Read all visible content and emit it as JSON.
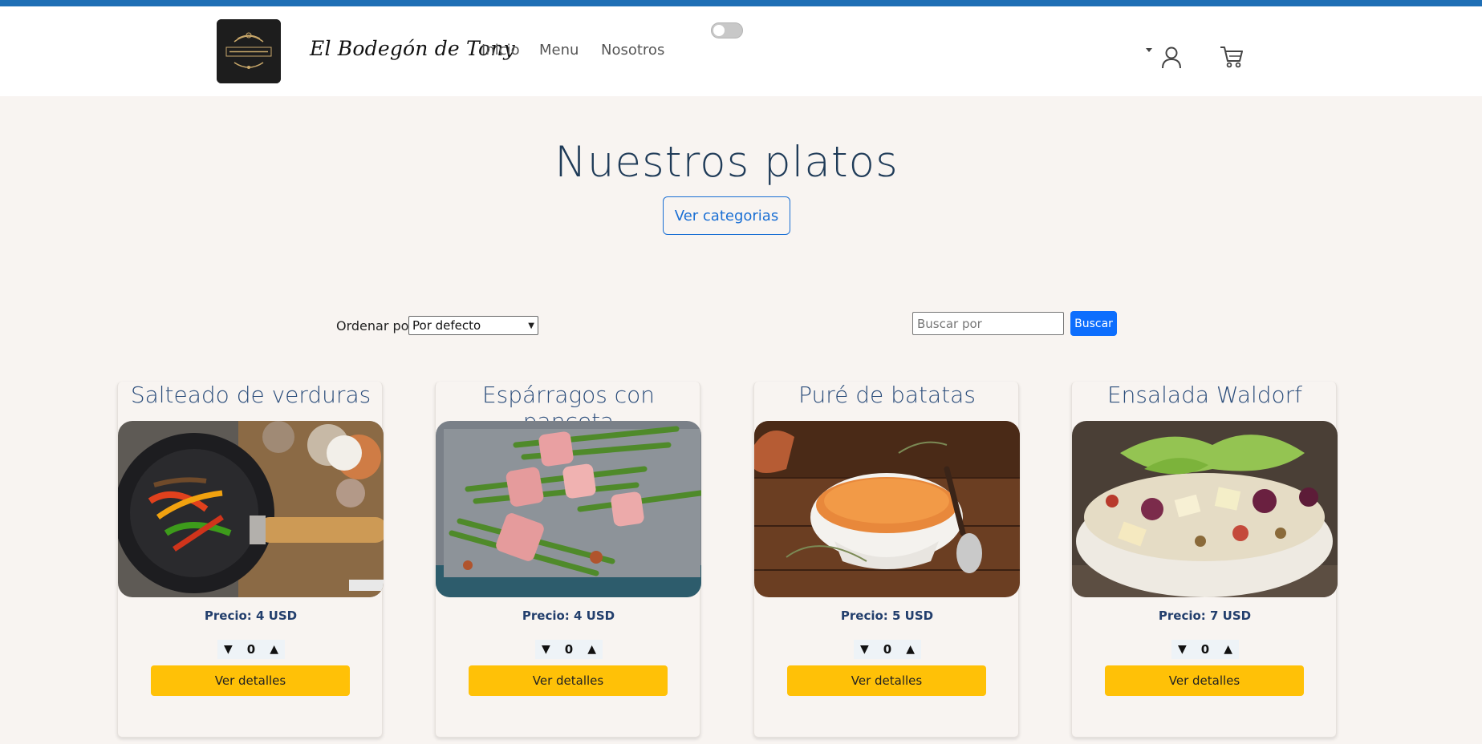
{
  "nav": {
    "brand": "El Bodegón de Tony",
    "links": [
      "Inicio",
      "Menu",
      "Nosotros"
    ]
  },
  "hero": {
    "title": "Nuestros platos",
    "categories_button": "Ver categorias"
  },
  "controls": {
    "sort_label": "Ordenar por:",
    "sort_value": "Por defecto",
    "search_placeholder": "Buscar por",
    "search_button": "Buscar"
  },
  "cards": [
    {
      "title": "Salteado de verduras",
      "price": "Precio: 4 USD",
      "qty": "0",
      "details": "Ver detalles"
    },
    {
      "title": "Espárragos con panceta",
      "price": "Precio: 4 USD",
      "qty": "0",
      "details": "Ver detalles"
    },
    {
      "title": "Puré de batatas",
      "price": "Precio: 5 USD",
      "qty": "0",
      "details": "Ver detalles"
    },
    {
      "title": "Ensalada Waldorf",
      "price": "Precio: 7 USD",
      "qty": "0",
      "details": "Ver detalles"
    }
  ],
  "colors": {
    "accent_blue": "#0d6efd",
    "stripe": "#1f6fb5",
    "details_yellow": "#ffc107",
    "heading": "#1f3b58",
    "background": "#f8f4f1"
  },
  "icons": [
    "user-icon",
    "cart-icon",
    "down-arrow-icon",
    "up-arrow-icon"
  ]
}
